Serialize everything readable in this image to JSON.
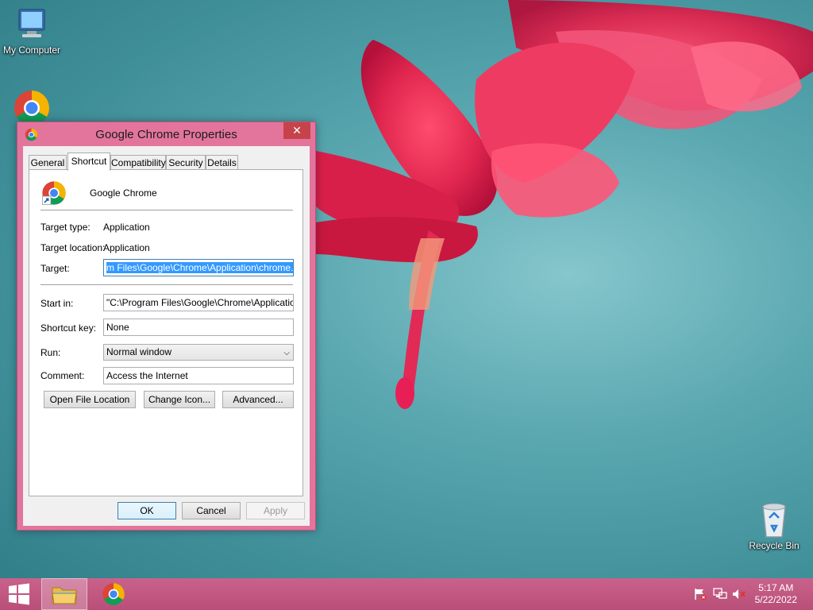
{
  "desktop": {
    "icons": {
      "my_computer": "My Computer",
      "recycle_bin": "Recycle Bin"
    }
  },
  "dialog": {
    "title": "Google Chrome Properties",
    "close_label": "✕",
    "tabs": [
      "General",
      "Shortcut",
      "Compatibility",
      "Security",
      "Details"
    ],
    "active_tab": "Shortcut",
    "app_name": "Google Chrome",
    "fields": {
      "target_type_label": "Target type:",
      "target_type_value": "Application",
      "target_location_label": "Target location:",
      "target_location_value": "Application",
      "target_label": "Target:",
      "target_value": "m Files\\Google\\Chrome\\Application\\chrome.exe\"",
      "start_in_label": "Start in:",
      "start_in_value": "\"C:\\Program Files\\Google\\Chrome\\Application\"",
      "shortcut_key_label": "Shortcut key:",
      "shortcut_key_value": "None",
      "run_label": "Run:",
      "run_value": "Normal window",
      "comment_label": "Comment:",
      "comment_value": "Access the Internet"
    },
    "buttons": {
      "open_file_location": "Open File Location",
      "change_icon": "Change Icon...",
      "advanced": "Advanced...",
      "ok": "OK",
      "cancel": "Cancel",
      "apply": "Apply"
    }
  },
  "taskbar": {
    "time": "5:17 AM",
    "date": "5/22/2022"
  },
  "colors": {
    "window_frame": "#e3759c",
    "taskbar": "#c0587f",
    "selection": "#3399ff",
    "close_button": "#c7434b"
  },
  "icons": {
    "start": "windows-logo-icon",
    "explorer": "folder-icon",
    "chrome": "chrome-icon",
    "tray": [
      "flag-icon",
      "network-icon",
      "speaker-muted-icon"
    ]
  }
}
